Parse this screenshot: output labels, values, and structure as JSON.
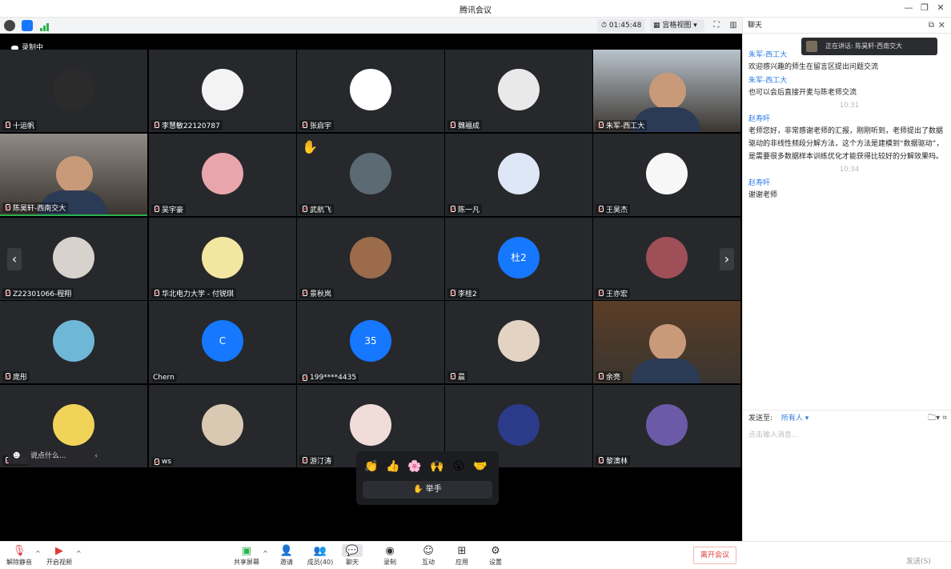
{
  "window": {
    "title": "腾讯会议",
    "controls": [
      "—",
      "❐",
      "✕"
    ]
  },
  "toolbar": {
    "timer": "01:45:48",
    "view_label": "宫格视图"
  },
  "stage": {
    "recording_label": "录制中",
    "raised_hand": "✋",
    "prev_arrow": "‹",
    "next_arrow": "›"
  },
  "tiles": [
    {
      "name": "十运帆",
      "type": "avatar",
      "color": "#2b2b2b",
      "glyph": ""
    },
    {
      "name": "李慧敏22120787",
      "type": "avatar",
      "color": "#f3f3f3",
      "glyph": ""
    },
    {
      "name": "张启宇",
      "type": "avatar",
      "color": "#ffffff",
      "glyph": ""
    },
    {
      "name": "魏福成",
      "type": "avatar",
      "color": "#e9e9e9",
      "glyph": ""
    },
    {
      "name": "朱军-西工大",
      "type": "camera",
      "color": "#b9c3cc",
      "glyph": ""
    },
    {
      "name": "陈昊轩-西南交大",
      "type": "camera",
      "color": "#8f8a83",
      "glyph": ""
    },
    {
      "name": "吴宇豪",
      "type": "avatar",
      "color": "#e8a6ac",
      "glyph": ""
    },
    {
      "name": "武航飞",
      "type": "avatar",
      "color": "#5b6a73",
      "glyph": ""
    },
    {
      "name": "陈一凡",
      "type": "avatar",
      "color": "#dde7f5",
      "glyph": ""
    },
    {
      "name": "王昊杰",
      "type": "avatar",
      "color": "#f7f7f7",
      "glyph": ""
    },
    {
      "name": "Z22301066-程翔",
      "type": "avatar",
      "color": "#d8d2cc",
      "glyph": ""
    },
    {
      "name": "华北电力大学 - 付锐琪",
      "type": "avatar",
      "color": "#f2e6a0",
      "glyph": ""
    },
    {
      "name": "景秋岚",
      "type": "avatar",
      "color": "#9b6b4a",
      "glyph": ""
    },
    {
      "name": "李桂2",
      "type": "initials",
      "color": "#1677ff",
      "glyph": "杜2"
    },
    {
      "name": "王亦宏",
      "type": "avatar",
      "color": "#9e4f58",
      "glyph": ""
    },
    {
      "name": "庞彤",
      "type": "avatar",
      "color": "#6fb7d6",
      "glyph": ""
    },
    {
      "name": "Chern",
      "type": "initials",
      "color": "#1677ff",
      "glyph": "C"
    },
    {
      "name": "199****4435",
      "type": "initials",
      "color": "#1677ff",
      "glyph": "35"
    },
    {
      "name": "晨",
      "type": "avatar",
      "color": "#e3d3c2",
      "glyph": ""
    },
    {
      "name": "余亮",
      "type": "camera",
      "color": "#5a3d26",
      "glyph": ""
    },
    {
      "name": "许阳",
      "type": "avatar",
      "color": "#f2d35a",
      "glyph": ""
    },
    {
      "name": "ws",
      "type": "avatar",
      "color": "#d9c9b3",
      "glyph": ""
    },
    {
      "name": "游汀涛",
      "type": "avatar",
      "color": "#f0dcd8",
      "glyph": ""
    },
    {
      "name": "",
      "type": "avatar",
      "color": "#2b3b8a",
      "glyph": ""
    },
    {
      "name": "黎澳林",
      "type": "avatar",
      "color": "#6a5aa8",
      "glyph": ""
    }
  ],
  "reactions": {
    "emojis": [
      "👏",
      "👍",
      "🌸",
      "🙌",
      "😮",
      "🤝"
    ],
    "raise_hand": "✋ 举手"
  },
  "chat_input_overlay": "说点什么...",
  "controls": {
    "mute": "解除静音",
    "video": "开启视频",
    "share": "共享屏幕",
    "invite": "邀请",
    "members": "成员(40)",
    "chat": "聊天",
    "record": "录制",
    "apps_react": "互动",
    "apps": "应用",
    "settings": "设置",
    "leave": "离开会议"
  },
  "chat": {
    "header": "聊天",
    "speaking": "正在讲话: 陈昊轩-西南交大",
    "messages": [
      {
        "kind": "sender",
        "text": "朱军-西工大"
      },
      {
        "kind": "text",
        "text": "欢迎感兴趣的师生在留言区提出问题交流"
      },
      {
        "kind": "sender",
        "text": "朱军-西工大"
      },
      {
        "kind": "text",
        "text": "也可以会后直接开麦与陈老师交流"
      },
      {
        "kind": "time",
        "text": "10:31"
      },
      {
        "kind": "sender",
        "text": "赵寿旰"
      },
      {
        "kind": "text",
        "text": "老师您好，非常感谢老师的汇报，刚刚听到，老师提出了数据驱动的非线性频段分解方法，这个方法是建模到“数据驱动”，是需要很多数据样本训练优化才能获得比较好的分解效果吗。"
      },
      {
        "kind": "time",
        "text": "10:34"
      },
      {
        "kind": "sender",
        "text": "赵寿旰"
      },
      {
        "kind": "text",
        "text": "谢谢老师"
      }
    ],
    "send_to_label": "发送至:",
    "send_to_value": "所有人 ▾",
    "input_placeholder": "点击输入消息...",
    "send_button": "发送(S)"
  }
}
